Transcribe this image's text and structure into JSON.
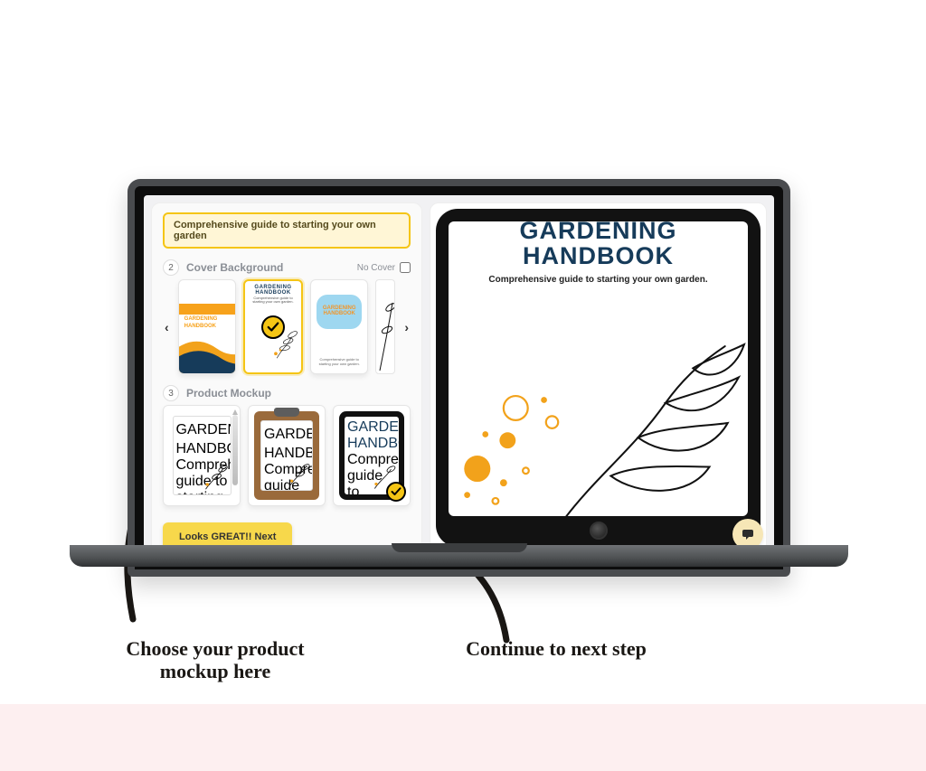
{
  "tagline": "Comprehensive guide to starting your own garden",
  "sections": {
    "cover": {
      "step": "2",
      "title": "Cover Background",
      "noCoverLabel": "No Cover"
    },
    "mockup": {
      "step": "3",
      "title": "Product Mockup"
    }
  },
  "book": {
    "title_line1": "GARDENING",
    "title_line2": "HANDBOOK",
    "subtitle": "Comprehensive guide to starting your own garden.",
    "mini_sub": "Comprehensive guide to starting your own garden."
  },
  "button": {
    "next": "Looks GREAT!! Next"
  },
  "annotations": {
    "mockup": "Choose your product\nmockup here",
    "continue": "Continue to next step"
  },
  "nav": {
    "prev": "‹",
    "next": "›"
  },
  "colors": {
    "accent": "#f5c515",
    "navy": "#163b5a"
  }
}
